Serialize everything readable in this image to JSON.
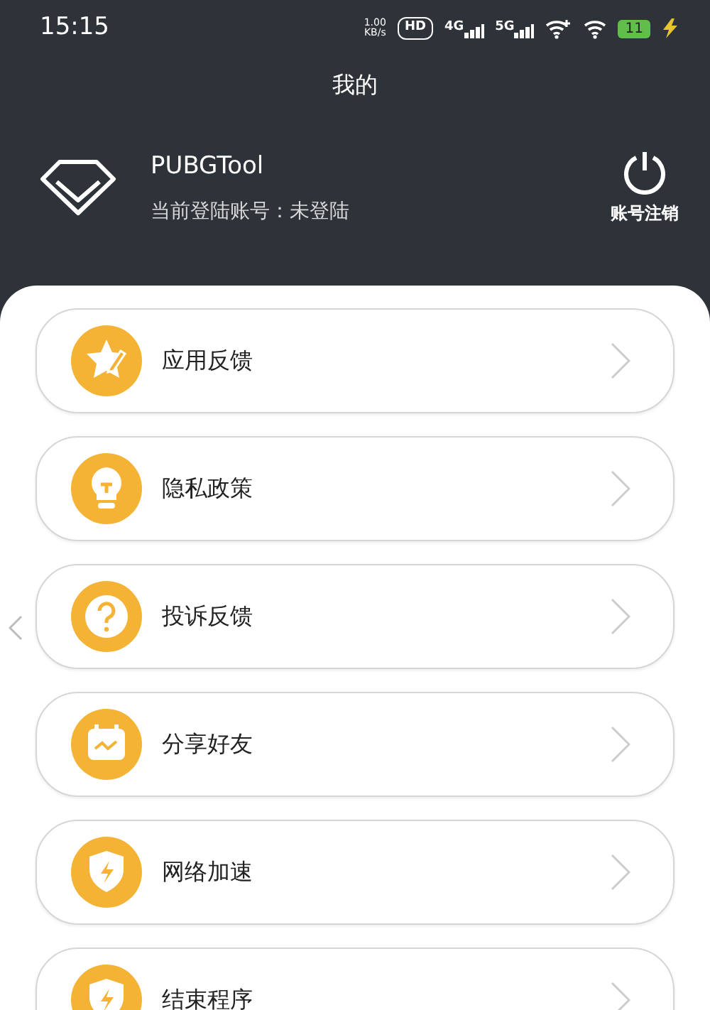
{
  "status_bar": {
    "time": "15:15",
    "speed": "1.00\nKB/s",
    "hd": "HD",
    "sim1": "4G",
    "sim2": "5G",
    "battery": "11"
  },
  "title": "我的",
  "profile": {
    "app_name": "PUBGTool",
    "account_label": "当前登陆账号：",
    "account_value": "未登陆",
    "logout_label": "账号注销"
  },
  "menu": [
    {
      "label": "应用反馈",
      "kind": "feedback"
    },
    {
      "label": "隐私政策",
      "kind": "bulb"
    },
    {
      "label": "投诉反馈",
      "kind": "question"
    },
    {
      "label": "分享好友",
      "kind": "share"
    },
    {
      "label": "网络加速",
      "kind": "shield"
    },
    {
      "label": "结束程序",
      "kind": "shield"
    }
  ]
}
